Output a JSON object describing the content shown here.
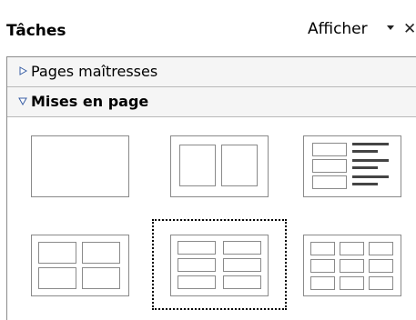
{
  "panel": {
    "title": "Tâches",
    "view_menu_label": "Afficher",
    "dropdown_icon": "chevron-down-icon",
    "close_icon": "close-icon",
    "close_glyph": "✕"
  },
  "sections": {
    "master_pages": {
      "label": "Pages maîtresses",
      "expanded": false
    },
    "layouts": {
      "label": "Mises en page",
      "expanded": true
    }
  },
  "layouts": {
    "selected_index": 4,
    "items": [
      "blank-slide",
      "two-columns",
      "title-content-list",
      "four-boxes",
      "six-boxes",
      "nine-boxes"
    ]
  },
  "colors": {
    "border": "#8a8a8a",
    "header_bg": "#f5f5f5"
  }
}
